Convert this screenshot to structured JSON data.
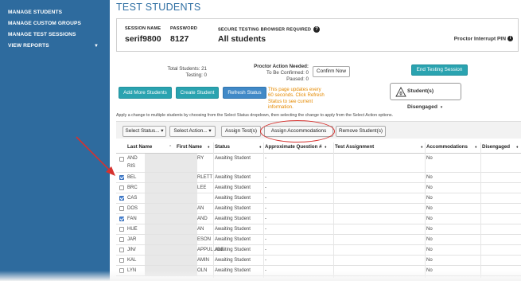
{
  "sidebar": {
    "items": [
      {
        "label": "MANAGE STUDENTS"
      },
      {
        "label": "MANAGE CUSTOM GROUPS"
      },
      {
        "label": "MANAGE TEST SESSIONS"
      },
      {
        "label": "VIEW REPORTS",
        "has_caret": true
      }
    ]
  },
  "page_title": "TEST STUDENTS",
  "session": {
    "name_label": "SESSION NAME",
    "name_value": "serif9800",
    "password_label": "PASSWORD",
    "password_value": "8127",
    "browser_label": "SECURE TESTING BROWSER REQUIRED",
    "browser_value": "All students",
    "help_icon": "?",
    "pin_label": "Proctor Interrupt PIN",
    "pin_icon": "i"
  },
  "stats": {
    "total_label": "Total Students: 21",
    "testing_label": "Testing: 0"
  },
  "proctor_action": {
    "title": "Proctor Action Needed:",
    "confirm_line": "To Be Confirmed: 0",
    "paused_line": "Paused: 0",
    "confirm_button": "Confirm Now"
  },
  "buttons": {
    "end_session": "End Testing Session",
    "add_more": "Add More Students",
    "create_student": "Create Student",
    "refresh_status": "Refresh Status"
  },
  "refresh_note": "This page updates every 60 seconds. Click Refresh Status to see current information.",
  "disengaged": {
    "count": "0",
    "label": "Student(s) Disengaged",
    "caret": "▾"
  },
  "instruction": "Apply a change to multiple students by choosing from the Select Status dropdown, then selecting the change to apply from the Select Action options.",
  "action_bar": {
    "select_status": "Select Status...",
    "select_action": "Select Action...",
    "assign_tests": "Assign Test(s)",
    "assign_accommodations": "Assign Accommodations",
    "remove_students": "Remove Student(s)",
    "caret": "▾"
  },
  "table": {
    "columns": [
      "Last Name",
      "First Name",
      "Status",
      "Approximate Question #",
      "Test Assignment",
      "Accommodations",
      "Disengaged"
    ],
    "sort_glyphs": [
      "⌃",
      "♦",
      "♦",
      "♦",
      "♦",
      "♦",
      "♦"
    ],
    "rows": [
      {
        "checked": false,
        "last": "AND",
        "last2": "RIS",
        "first": "RY",
        "status": "Awaiting Student",
        "question": "-",
        "accommodations": "No"
      },
      {
        "checked": true,
        "last": "BEL",
        "first": "RLETT",
        "status": "Awaiting Student",
        "question": "-",
        "accommodations": "No"
      },
      {
        "checked": false,
        "last": "BRC",
        "first": "LEE",
        "status": "Awaiting Student",
        "question": "-",
        "accommodations": "No"
      },
      {
        "checked": true,
        "last": "CAS",
        "first": "",
        "status": "Awaiting Student",
        "question": "-",
        "accommodations": "No"
      },
      {
        "checked": false,
        "last": "DOS",
        "first": "AN",
        "status": "Awaiting Student",
        "question": "-",
        "accommodations": "No"
      },
      {
        "checked": true,
        "last": "FAN",
        "first": "AND",
        "status": "Awaiting Student",
        "question": "-",
        "accommodations": "No"
      },
      {
        "checked": false,
        "last": "HUE",
        "first": "AN",
        "status": "Awaiting Student",
        "question": "-",
        "accommodations": "No"
      },
      {
        "checked": false,
        "last": "JAR",
        "first": "ESON",
        "status": "Awaiting Student",
        "question": "-",
        "accommodations": "No"
      },
      {
        "checked": false,
        "last": "JIN/",
        "first": "APPULLIGE",
        "status": "Awaiting Student",
        "question": "-",
        "accommodations": "No"
      },
      {
        "checked": false,
        "last": "KAL",
        "first": "AMIN",
        "status": "Awaiting Student",
        "question": "-",
        "accommodations": "No"
      },
      {
        "checked": false,
        "last": "LYN",
        "first": "OLN",
        "status": "Awaiting Student",
        "question": "-",
        "accommodations": "No"
      }
    ]
  },
  "colors": {
    "sidebar": "#2e6b9e",
    "title": "#2f6fa3",
    "teal": "#2aa3b0",
    "blue": "#4189c7",
    "note": "#e58a00",
    "annotation_red": "#d6322f"
  }
}
